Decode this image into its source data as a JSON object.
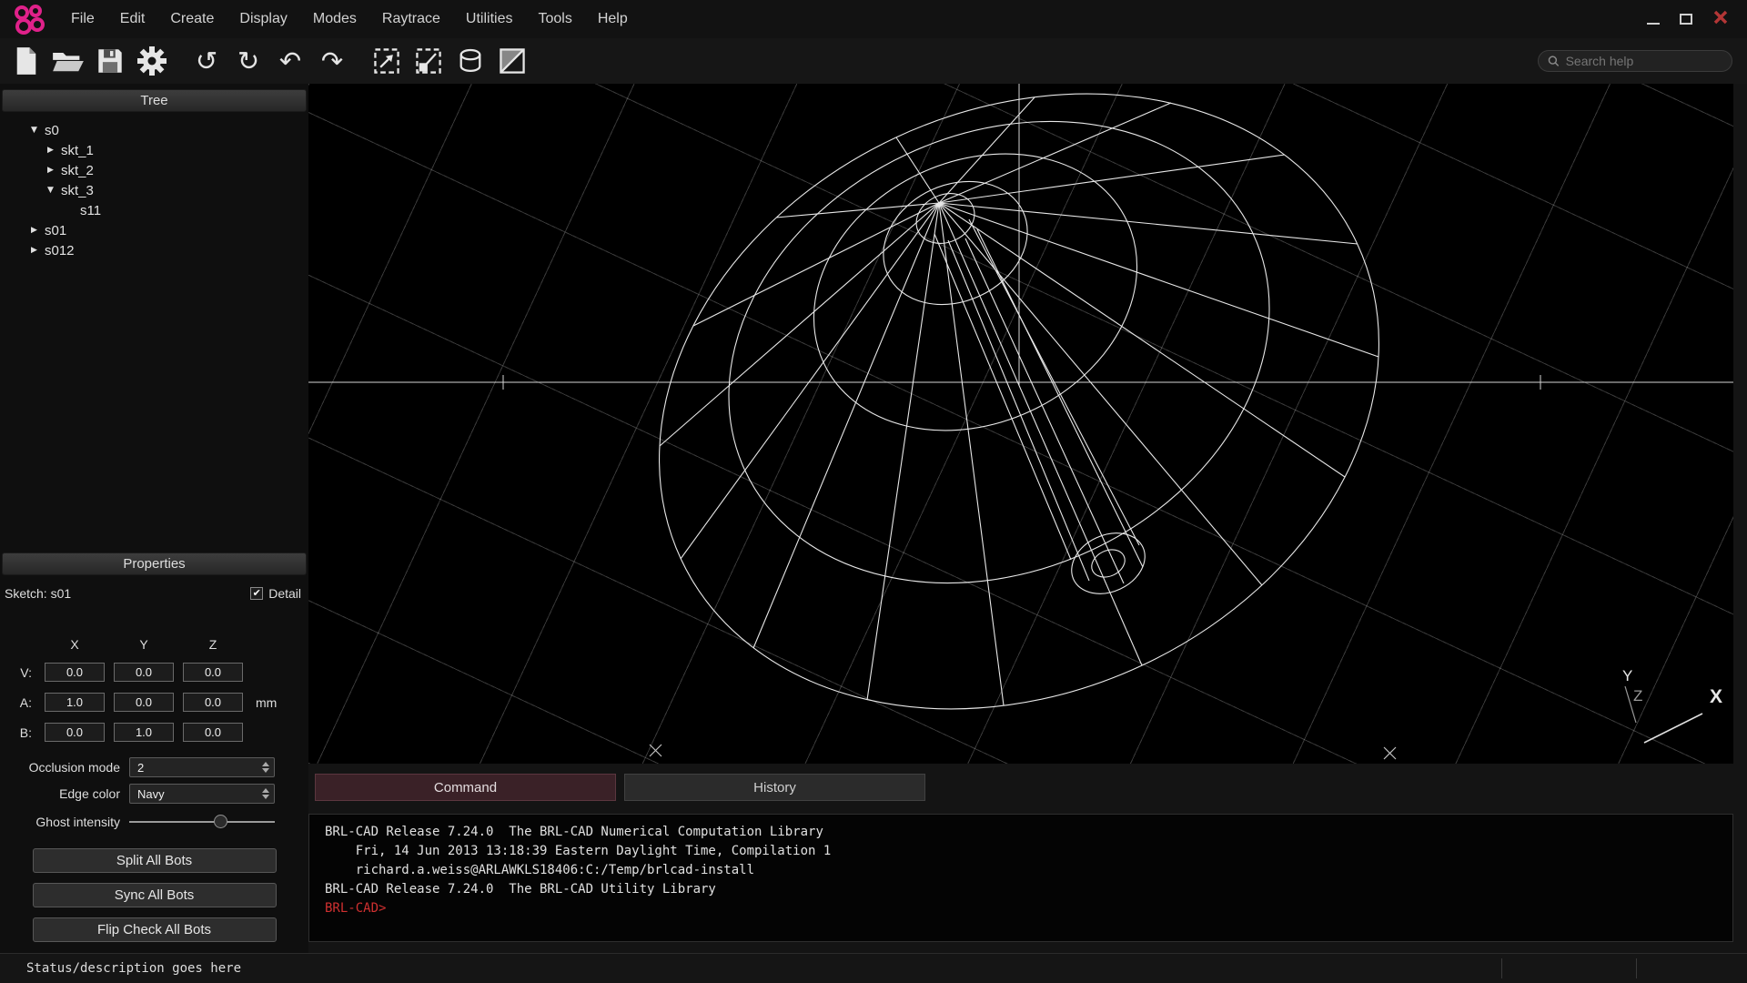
{
  "titlebar": {
    "menus": [
      "File",
      "Edit",
      "Create",
      "Display",
      "Modes",
      "Raytrace",
      "Utilities",
      "Tools",
      "Help"
    ]
  },
  "toolbar": {
    "search_placeholder": "Search help",
    "icons": {
      "undo": "↺",
      "redo": "↻",
      "rotate_left": "↶",
      "rotate_right": "↷"
    }
  },
  "tree": {
    "title": "Tree",
    "items": [
      {
        "arrow": "▼",
        "label": "s0"
      },
      {
        "arrow": "▶",
        "label": "skt_1"
      },
      {
        "arrow": "▶",
        "label": "skt_2"
      },
      {
        "arrow": "▼",
        "label": "skt_3"
      },
      {
        "arrow": "",
        "label": "s11"
      },
      {
        "arrow": "▶",
        "label": "s01"
      },
      {
        "arrow": "▶",
        "label": "s012"
      }
    ]
  },
  "properties": {
    "title": "Properties",
    "sketch_label": "Sketch: s01",
    "detail_label": "Detail",
    "detail_check": "✔",
    "col_headers": [
      "X",
      "Y",
      "Z"
    ],
    "rows": [
      {
        "label": "V:",
        "x": "0.0",
        "y": "0.0",
        "z": "0.0",
        "unit": ""
      },
      {
        "label": "A:",
        "x": "1.0",
        "y": "0.0",
        "z": "0.0",
        "unit": "mm"
      },
      {
        "label": "B:",
        "x": "0.0",
        "y": "1.0",
        "z": "0.0",
        "unit": ""
      }
    ],
    "occlusion_label": "Occlusion mode",
    "occlusion_value": "2",
    "edge_label": "Edge color",
    "edge_value": "Navy",
    "ghost_label": "Ghost intensity",
    "buttons": [
      "Split All Bots",
      "Sync All Bots",
      "Flip Check All Bots"
    ]
  },
  "viewport": {
    "axes": {
      "x": "X",
      "y": "Y",
      "z": "Z"
    }
  },
  "console": {
    "tabs": [
      "Command",
      "History"
    ],
    "lines": [
      "BRL-CAD Release 7.24.0  The BRL-CAD Numerical Computation Library",
      "    Fri, 14 Jun 2013 13:18:39 Eastern Daylight Time, Compilation 1",
      "    richard.a.weiss@ARLAWKLS18406:C:/Temp/brlcad-install",
      "BRL-CAD Release 7.24.0  The BRL-CAD Utility Library"
    ],
    "prompt": "BRL-CAD>"
  },
  "statusbar": {
    "text": "Status/description goes here"
  },
  "colors": {
    "accent_magenta": "#e0218a",
    "prompt_red": "#d03030",
    "active_tab": "#3a2127"
  }
}
